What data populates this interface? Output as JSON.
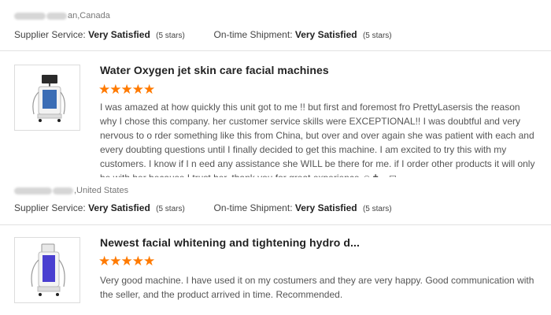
{
  "reviews": [
    {
      "reviewer": {
        "location": "an,Canada"
      },
      "supplier_service": {
        "label": "Supplier Service:",
        "value": "Very Satisfied",
        "stars": "(5 stars)"
      },
      "ontime_shipment": {
        "label": "On-time Shipment:",
        "value": "Very Satisfied",
        "stars": "(5 stars)"
      },
      "product_title": "Water Oxygen jet skin care facial machines",
      "rating": "★★★★★",
      "text": "I was amazed at how quickly this unit got to me !! but first and foremost fro PrettyLasersis the reason why I chose this company. her customer service skills were EXCEPTIONAL!! I was doubtful and very nervous to o rder something like this from China, but over and over again she was patient with each and every doubting questions until I finally decided to get this machine. I am excited to try this with my customers. I know if I n eed any assistance she WILL be there for me. if I order other products it will only be with her because I trust her. thank you for great experience ☺✝☁◻"
    },
    {
      "reviewer": {
        "location": ",United States"
      },
      "supplier_service": {
        "label": "Supplier Service:",
        "value": "Very Satisfied",
        "stars": "(5 stars)"
      },
      "ontime_shipment": {
        "label": "On-time Shipment:",
        "value": "Very Satisfied",
        "stars": "(5 stars)"
      },
      "product_title": "Newest facial whitening and tightening hydro d...",
      "rating": "★★★★★",
      "text": "Very good machine. I have used it on my costumers and they are very happy. Good communication with the seller, and the product arrived in time. Recommended."
    }
  ],
  "colors": {
    "star": "#ff7a00",
    "divider": "#e2e2e2"
  }
}
